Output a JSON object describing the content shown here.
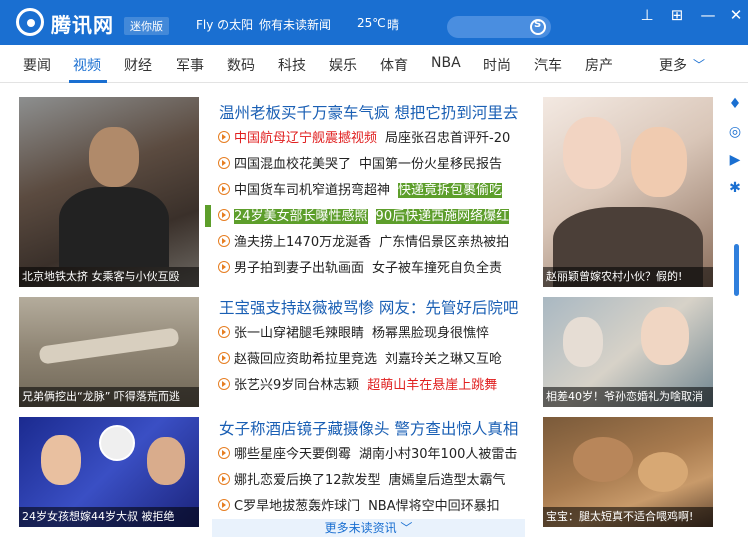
{
  "titlebar": {
    "brand": "腾讯网",
    "mini_badge": "迷你版",
    "user": "Fly の太阳",
    "news_notice": "你有未读新闻",
    "temperature": "25℃",
    "weather": "晴",
    "colors": {
      "bar": "#1a6fd1"
    }
  },
  "nav": {
    "items": [
      "要闻",
      "视频",
      "财经",
      "军事",
      "数码",
      "科技",
      "娱乐",
      "体育",
      "NBA",
      "时尚",
      "汽车",
      "房产"
    ],
    "active": "视频",
    "more": "更多"
  },
  "tiles": [
    {
      "caption": "北京地铁太挤 女乘客与小伙互殴"
    },
    {
      "caption": "赵丽颖曾嫁农村小伙？假的!"
    },
    {
      "caption": "兄弟俩挖出“龙脉” 吓得落荒而逃"
    },
    {
      "caption": "相差40岁！爷孙恋婚礼为啥取消"
    },
    {
      "caption": "24岁女孩想嫁44岁大叔 被拒绝"
    },
    {
      "caption": "宝宝：腿太短真不适合喂鸡啊!"
    }
  ],
  "sections": [
    {
      "headline": "温州老板买千万豪车气疯 想把它扔到河里去",
      "rows": [
        {
          "a": "中国航母辽宁舰震撼视频",
          "a_red": true,
          "b": "局座张召忠首评歼-20"
        },
        {
          "a": "四国混血校花美哭了",
          "b": "中国第一份火星移民报告"
        },
        {
          "a": "中国货车司机窄道拐弯超神",
          "b": "快递竟拆包裹偷吃",
          "b_sel": true
        },
        {
          "a": "24岁美女部长曝性感照",
          "a_sel": true,
          "b": "90后快递西施网络爆红",
          "b_sel": true
        },
        {
          "a": "渔夫捞上1470万龙涎香",
          "b": "广东情侣景区亲热被拍"
        },
        {
          "a": "男子拍到妻子出轨画面",
          "b": "女子被车撞死自负全责"
        }
      ]
    },
    {
      "headline": "王宝强支持赵薇被骂惨 网友：先管好后院吧",
      "rows": [
        {
          "a": "张一山穿裙腿毛辣眼睛",
          "b": "杨幂黑脸现身很憔悴"
        },
        {
          "a": "赵薇回应资助希拉里竞选",
          "b": "刘嘉玲关之琳又互呛"
        },
        {
          "a": "张艺兴9岁同台林志颖",
          "b": "超萌山羊在悬崖上跳舞",
          "b_red": true
        }
      ]
    },
    {
      "headline": "女子称酒店镜子藏摄像头 警方查出惊人真相",
      "rows": [
        {
          "a": "哪些星座今天要倒霉",
          "b": "湖南小村30年100人被雷击"
        },
        {
          "a": "娜扎恋爱后换了12款发型",
          "b": "唐嫣皇后造型太霸气"
        },
        {
          "a": "C罗旱地拔葱轰炸球门",
          "b": "NBA悍将空中回环暴扣"
        }
      ]
    }
  ],
  "more_news": "更多未读资讯"
}
